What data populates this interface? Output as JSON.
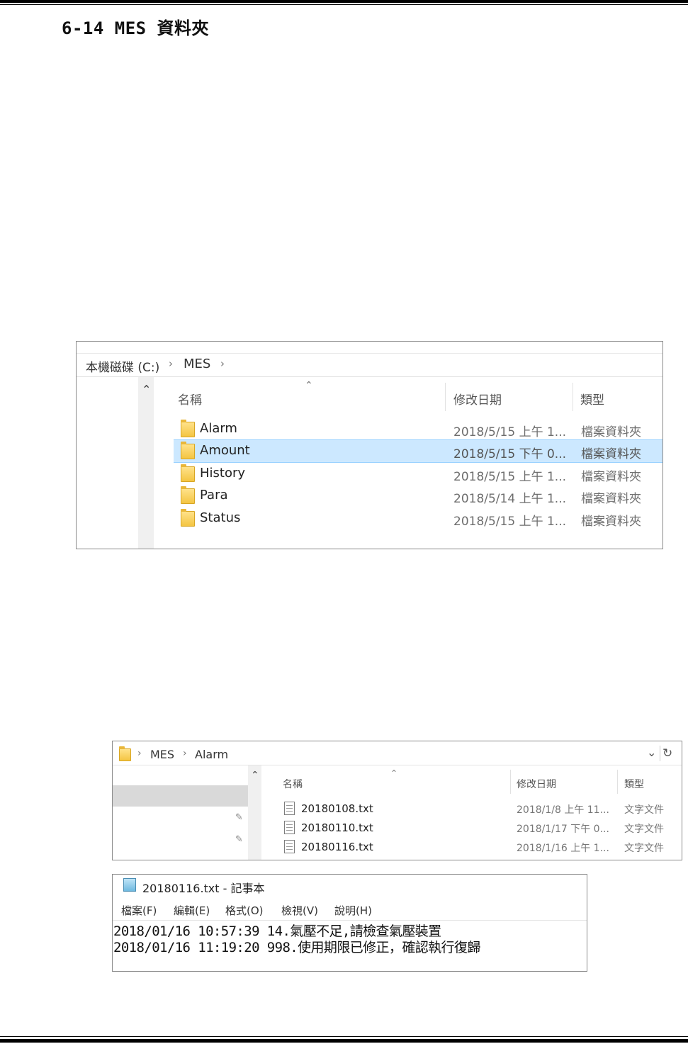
{
  "heading": "6-14 MES 資料夾",
  "explorer1": {
    "breadcrumb": [
      "本機磁碟 (C:)",
      "MES"
    ],
    "columns": {
      "name": "名稱",
      "modified": "修改日期",
      "type": "類型"
    },
    "items": [
      {
        "name": "Alarm",
        "modified": "2018/5/15 上午 1...",
        "type": "檔案資料夾",
        "selected": false
      },
      {
        "name": "Amount",
        "modified": "2018/5/15 下午 0...",
        "type": "檔案資料夾",
        "selected": true
      },
      {
        "name": "History",
        "modified": "2018/5/15 上午 1...",
        "type": "檔案資料夾",
        "selected": false
      },
      {
        "name": "Para",
        "modified": "2018/5/14 上午 1...",
        "type": "檔案資料夾",
        "selected": false
      },
      {
        "name": "Status",
        "modified": "2018/5/15 上午 1...",
        "type": "檔案資料夾",
        "selected": false
      }
    ]
  },
  "explorer2": {
    "breadcrumb": [
      "MES",
      "Alarm"
    ],
    "columns": {
      "name": "名稱",
      "modified": "修改日期",
      "type": "類型"
    },
    "items": [
      {
        "name": "20180108.txt",
        "modified": "2018/1/8 上午 11...",
        "type": "文字文件"
      },
      {
        "name": "20180110.txt",
        "modified": "2018/1/17 下午 0...",
        "type": "文字文件"
      },
      {
        "name": "20180116.txt",
        "modified": "2018/1/16 上午 1...",
        "type": "文字文件"
      }
    ]
  },
  "notepad": {
    "title": "20180116.txt - 記事本",
    "menu": [
      "檔案(F)",
      "編輯(E)",
      "格式(O)",
      "檢視(V)",
      "說明(H)"
    ],
    "lines": [
      "2018/01/16 10:57:39 14.氣壓不足,請檢查氣壓裝置",
      "2018/01/16 11:19:20 998.使用期限已修正，確認執行復歸"
    ]
  }
}
